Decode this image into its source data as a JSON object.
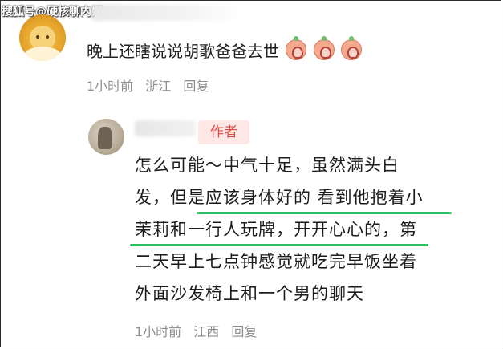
{
  "watermark": "搜狐号@硬核聊内娱",
  "comment": {
    "text": "晚上还瞎说说胡歌爸爸去世",
    "emojis": [
      "crying-face-icon",
      "crying-face-icon",
      "crying-face-icon"
    ],
    "time": "1小时前",
    "location": "浙江",
    "reply_label": "回复"
  },
  "reply": {
    "author_badge": "作者",
    "lines": [
      "怎么可能～中气十足，虽然满头白",
      "发，但是应该身体好的 看到他抱着小",
      "茉莉和一行人玩牌，开开心心的，第",
      "二天早上七点钟感觉就吃完早饭坐着",
      "外面沙发椅上和一个男的聊天"
    ],
    "time": "1小时前",
    "location": "江西",
    "reply_label": "回复",
    "highlight_color": "#2dbf65"
  }
}
